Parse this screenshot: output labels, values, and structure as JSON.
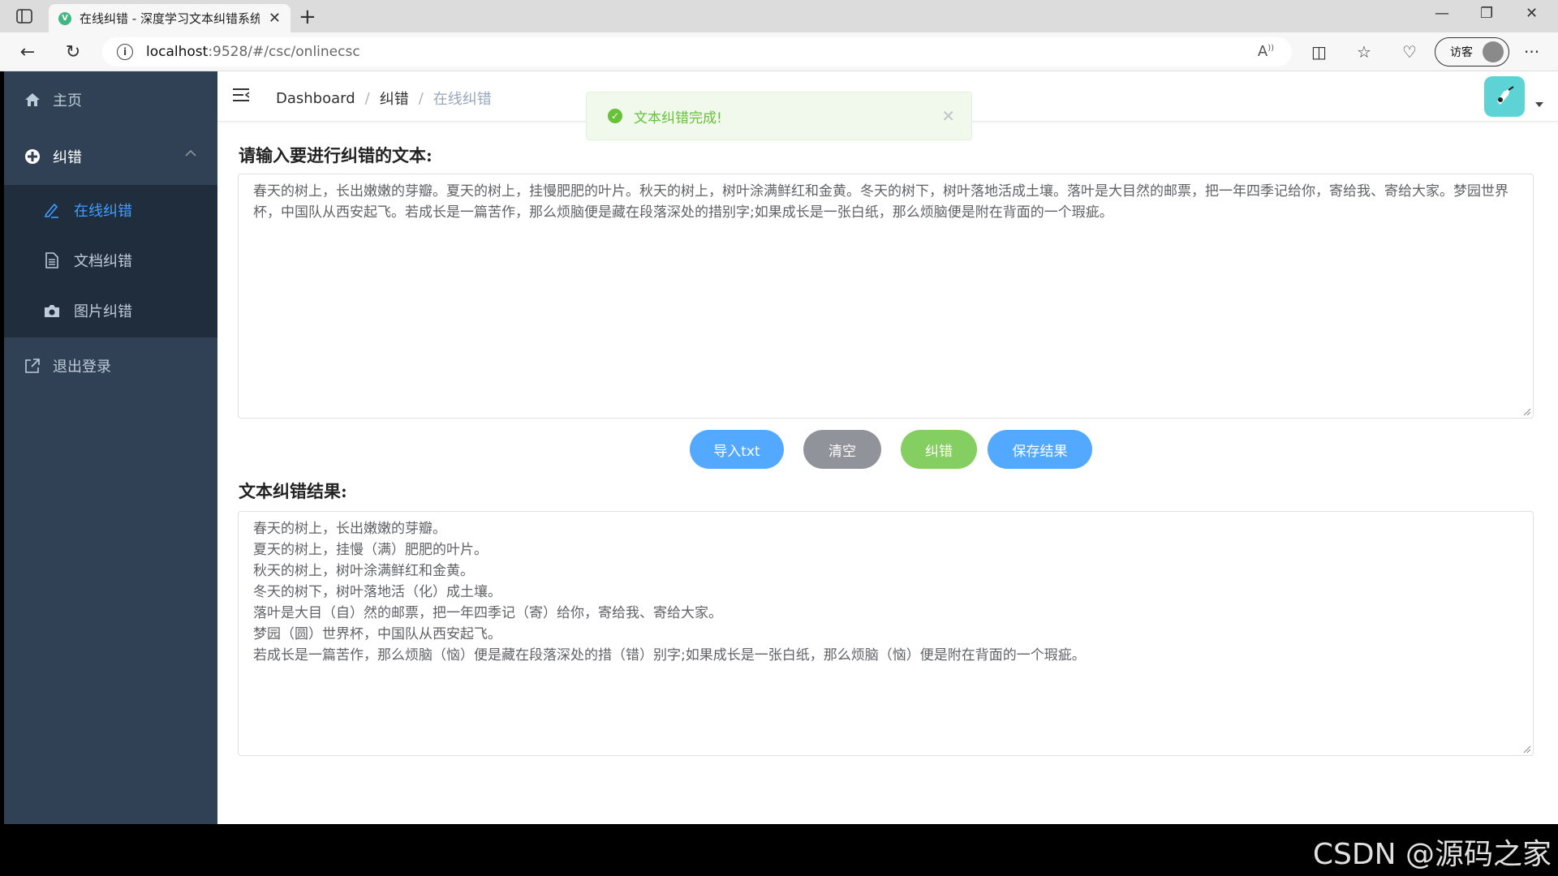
{
  "browser": {
    "tab_title": "在线纠错 - 深度学习文本纠错系统",
    "favicon_letter": "V",
    "url_host": "localhost",
    "url_rest": ":9528/#/csc/onlinecsc",
    "guest_label": "访客"
  },
  "sidebar": {
    "home": "主页",
    "correction_group": "纠错",
    "sub_items": [
      "在线纠错",
      "文档纠错",
      "图片纠错"
    ],
    "logout": "退出登录"
  },
  "breadcrumb": [
    "Dashboard",
    "纠错",
    "在线纠错"
  ],
  "toast": {
    "message": "文本纠错完成!"
  },
  "input_section": {
    "label": "请输入要进行纠错的文本:",
    "text": "春天的树上，长出嫩嫩的芽瓣。夏天的树上，挂慢肥肥的叶片。秋天的树上，树叶涂满鲜红和金黄。冬天的树下，树叶落地活成土壤。落叶是大目然的邮票，把一年四季记给你，寄给我、寄给大家。梦园世界杯，中国队从西安起飞。若成长是一篇苦作，那么烦脑便是藏在段落深处的措别字;如果成长是一张白纸，那么烦脑便是附在背面的一个瑕疵。"
  },
  "buttons": {
    "import": "导入txt",
    "clear": "清空",
    "correct": "纠错",
    "save": "保存结果"
  },
  "result_section": {
    "label": "文本纠错结果:",
    "text": "春天的树上，长出嫩嫩的芽瓣。\n夏天的树上，挂慢（满）肥肥的叶片。\n秋天的树上，树叶涂满鲜红和金黄。\n冬天的树下，树叶落地活（化）成土壤。\n落叶是大目（自）然的邮票，把一年四季记（寄）给你，寄给我、寄给大家。\n梦园（圆）世界杯，中国队从西安起飞。\n若成长是一篇苦作，那么烦脑（恼）便是藏在段落深处的措（错）别字;如果成长是一张白纸，那么烦脑（恼）便是附在背面的一个瑕疵。"
  },
  "watermark": "CSDN @源码之家",
  "colors": {
    "sidebar_bg": "#304156",
    "submenu_bg": "#1f2d3d",
    "active": "#409eff",
    "success": "#67c23a",
    "clear_btn": "#909399",
    "correct_btn": "#85ce61",
    "primary_btn": "#53a8ff"
  }
}
